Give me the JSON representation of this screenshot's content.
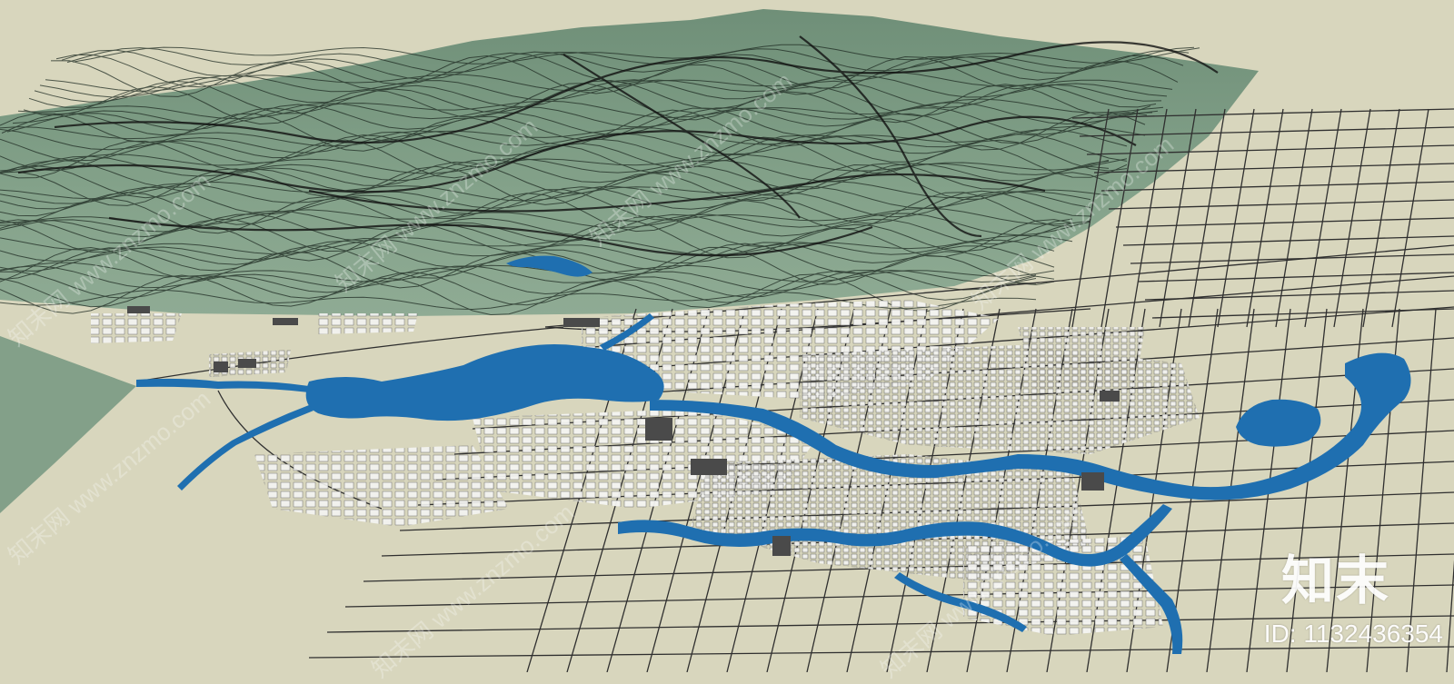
{
  "watermark": {
    "logo_text": "知末",
    "id_text": "ID: 1132436354",
    "repeat_text": "知末网 www.znzmo.com"
  },
  "colors": {
    "ground": "#d8d6bd",
    "terrain": "#7f9d85",
    "water": "#1f6fb0",
    "roads": "#2b2b2b",
    "buildings": "#f2f2f2"
  },
  "icons": [
    "terrain-model",
    "lake",
    "river",
    "road-grid",
    "building-blocks"
  ]
}
